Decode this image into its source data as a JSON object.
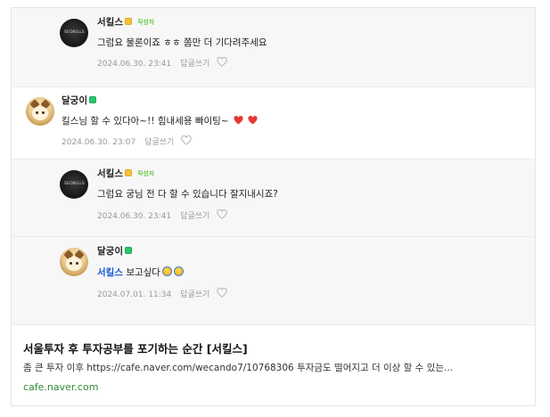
{
  "comments": [
    {
      "author": "서킬스",
      "author_badge": "yellow",
      "writer_tag": "작성자",
      "text": "그럼요 물론이죠 ㅎㅎ 쫌만 더 기다려주세요",
      "date": "2024.06.30. 23:41",
      "reply_label": "답글쓰기",
      "avatar_text": "SEOKILLS",
      "type": "reply"
    },
    {
      "author": "달궁이",
      "author_badge": "green",
      "text": "킬스님 할 수 있다아~!! 힘내세용 빠이팅~",
      "date": "2024.06.30. 23:07",
      "reply_label": "답글쓰기",
      "emojis": [
        "red-heart-emoji",
        "red-heart-emoji"
      ],
      "type": "top"
    },
    {
      "author": "서킬스",
      "author_badge": "yellow",
      "writer_tag": "작성자",
      "text": "그럼요 궁님 전 다 할 수 있습니다 잘지내시죠?",
      "date": "2024.06.30. 23:41",
      "reply_label": "답글쓰기",
      "avatar_text": "SEOKILLS",
      "type": "reply"
    },
    {
      "author": "달궁이",
      "author_badge": "green",
      "mention": "서킬스",
      "text": "보고싶다",
      "date": "2024.07.01. 11:34",
      "reply_label": "답글쓰기",
      "emojis": [
        "smiling-face-emoji",
        "smiling-face-emoji"
      ],
      "type": "reply"
    }
  ],
  "link_preview": {
    "title": "서울투자 후 투자공부를 포기하는 순간 [서킬스]",
    "description": "좀 큰 투자 이후 https://cafe.naver.com/wecando7/10768306 투자금도 떨어지고 더 이상 할 수 있는...",
    "domain": "cafe.naver.com"
  },
  "colors": {
    "reply_background": "#f7f7f7",
    "mention": "#1a5bd6",
    "meta_text": "#999999",
    "writer_tag": "#2db400",
    "domain": "#2e8b3a",
    "heart": "#e53935"
  },
  "icons": {
    "like": "heart-outline-icon",
    "author_badge": "level-badge-icon"
  }
}
